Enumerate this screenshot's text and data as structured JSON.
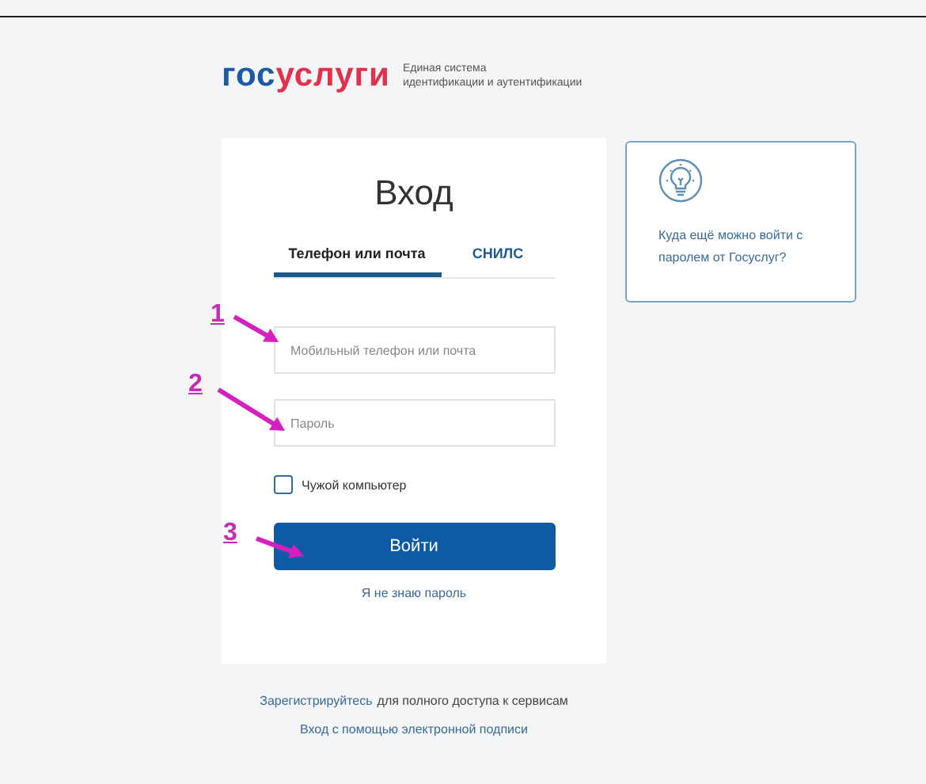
{
  "header": {
    "logo_parts": [
      "гос",
      "услуги"
    ],
    "tagline": [
      "Единая система",
      "идентификации и аутентификации"
    ]
  },
  "login": {
    "title": "Вход",
    "tabs": [
      {
        "label": "Телефон или почта",
        "selected": true
      },
      {
        "label": "СНИЛС",
        "selected": false
      }
    ],
    "fields": [
      {
        "placeholder": "Мобильный телефон или почта"
      },
      {
        "placeholder": "Пароль"
      }
    ],
    "checkbox": {
      "label": "Чужой компьютер",
      "checked": false
    },
    "submit": "Войти",
    "forgot": "Я не знаю пароль"
  },
  "info": {
    "text": "Куда ещё можно войти с паролем от Госуслуг?"
  },
  "register": {
    "link": "Зарегистрируйтесь",
    "text": "для полного доступа к сервисам"
  },
  "signature_link": "Вход с помощью электронной подписи",
  "annotations": [
    {
      "label": "1"
    },
    {
      "label": "2"
    },
    {
      "label": "3"
    }
  ]
}
